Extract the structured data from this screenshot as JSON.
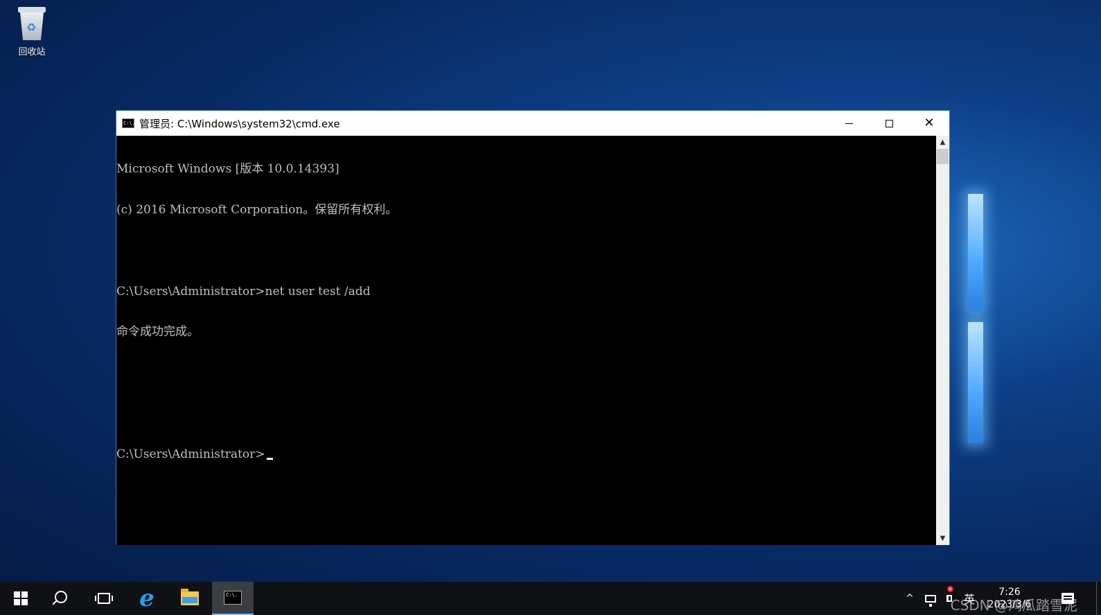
{
  "desktop": {
    "icons": [
      {
        "label": "回收站",
        "icon": "recycle-bin-icon"
      }
    ]
  },
  "window": {
    "title": "管理员: C:\\Windows\\system32\\cmd.exe",
    "app_icon": "C:\\.",
    "controls": {
      "minimize": "minimize-icon",
      "maximize": "maximize-icon",
      "close_glyph": "✕"
    },
    "console_lines": [
      "Microsoft Windows [版本 10.0.14393]",
      "(c) 2016 Microsoft Corporation。保留所有权利。",
      "",
      "C:\\Users\\Administrator>net user test /add",
      "命令成功完成。",
      "",
      "",
      "C:\\Users\\Administrator>"
    ],
    "scrollbar": {
      "up_arrow": "▲",
      "down_arrow": "▼"
    }
  },
  "taskbar": {
    "items": [
      {
        "name": "start-button",
        "icon": "windows-logo-icon"
      },
      {
        "name": "search-button",
        "icon": "search-icon"
      },
      {
        "name": "task-view-button",
        "icon": "task-view-icon"
      },
      {
        "name": "internet-explorer-button",
        "icon": "ie-icon",
        "glyph": "e"
      },
      {
        "name": "file-explorer-button",
        "icon": "folder-icon"
      },
      {
        "name": "cmd-button",
        "icon": "cmd-icon",
        "glyph": "C:\\.",
        "active": true
      }
    ],
    "tray": {
      "chevron": "^",
      "ime": "英",
      "time": "7:26",
      "date": "2023/3/6"
    },
    "watermark": "CSDN @鸿瓜踏雪泥"
  },
  "colors": {
    "console_bg": "#000000",
    "console_fg": "#c0c0c0",
    "taskbar_bg": "#101114",
    "accent": "#76b9ed"
  }
}
